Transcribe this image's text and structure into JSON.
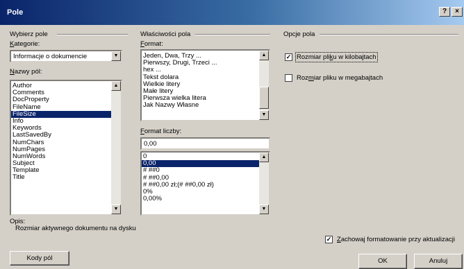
{
  "window": {
    "title": "Pole",
    "help_glyph": "?",
    "close_glyph": "×"
  },
  "choose_field": {
    "section_title": "Wybierz pole",
    "categories_label_u": "K",
    "categories_label_rest": "ategorie:",
    "category_value": "Informacje o dokumencie",
    "field_names_label_u": "N",
    "field_names_label_rest": "azwy pól:",
    "field_names": [
      "Author",
      "Comments",
      "DocProperty",
      "FileName",
      "FileSize",
      "Info",
      "Keywords",
      "LastSavedBy",
      "NumChars",
      "NumPages",
      "NumWords",
      "Subject",
      "Template",
      "Title"
    ],
    "selected_field": "FileSize"
  },
  "field_properties": {
    "section_title": "Właściwości pola",
    "format_label_u": "F",
    "format_label_rest": "ormat:",
    "formats": [
      "Jeden, Dwa, Trzy ...",
      "Pierwszy, Drugi, Trzeci ...",
      "hex ...",
      "Tekst dolara",
      "Wielkie litery",
      "Małe litery",
      "Pierwsza wielka litera",
      "Jak Nazwy Własne"
    ],
    "number_format_label_u": "F",
    "number_format_label_rest": "ormat liczby:",
    "number_format_value": "0,00",
    "number_formats": [
      "0",
      "0,00",
      "# ##0",
      "# ##0,00",
      "# ##0,00 zł;(# ##0,00 zł)",
      "0%",
      "0,00%"
    ],
    "selected_number_format": "0,00"
  },
  "field_options": {
    "section_title": "Opcje pola",
    "size_kb_label": "Rozmiar pliku w kilobajtach",
    "size_kb_underline": "k",
    "size_kb_checked": true,
    "size_mb_label": "Rozmiar pliku w megabajtach",
    "size_mb_underline": "m",
    "size_mb_checked": false
  },
  "description": {
    "label": "Opis:",
    "text": "Rozmiar aktywnego dokumentu na dysku"
  },
  "preserve_formatting": {
    "label": "Zachowaj formatowanie przy aktualizacji",
    "checked": true
  },
  "buttons": {
    "field_codes": "Kody pól",
    "ok": "OK",
    "cancel": "Anuluj"
  },
  "check_glyph": "✓"
}
